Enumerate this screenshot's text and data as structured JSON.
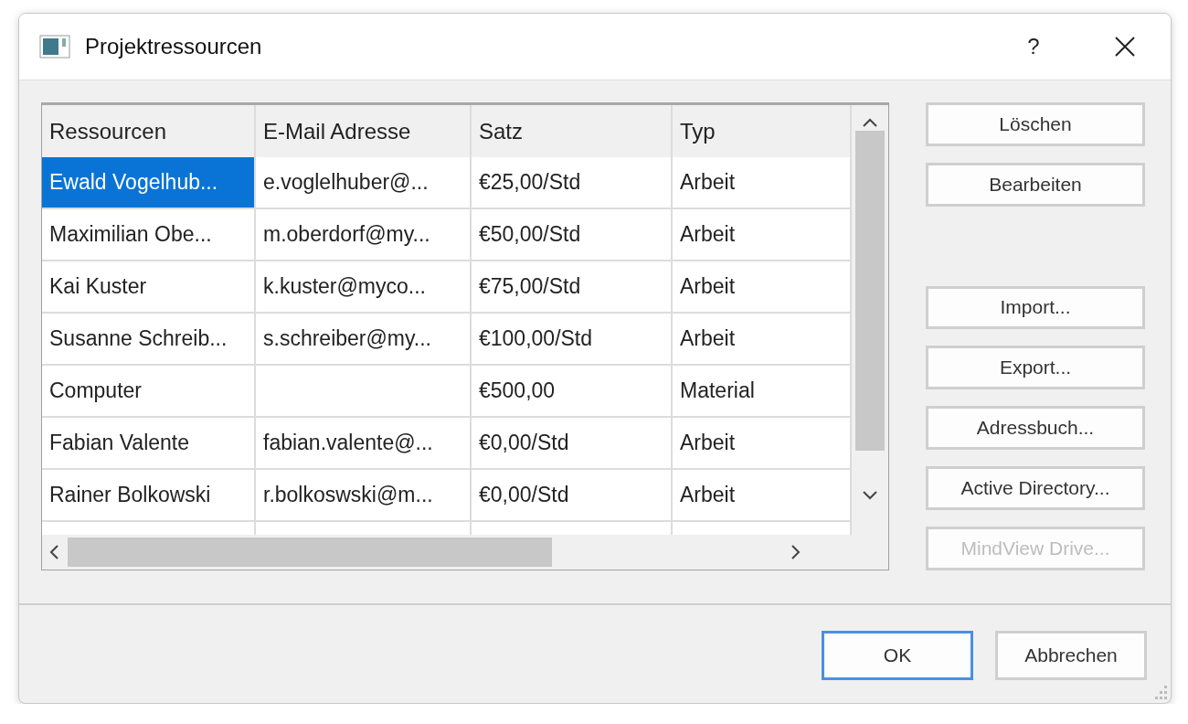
{
  "window": {
    "title": "Projektressourcen",
    "help": "?"
  },
  "table": {
    "columns": [
      "Ressourcen",
      "E-Mail Adresse",
      "Satz",
      "Typ"
    ],
    "rows": [
      {
        "cells": [
          "Ewald Vogelhub...",
          "e.voglelhuber@...",
          "€25,00/Std",
          "Arbeit"
        ],
        "selected": true
      },
      {
        "cells": [
          "Maximilian Obe...",
          "m.oberdorf@my...",
          "€50,00/Std",
          "Arbeit"
        ],
        "selected": false
      },
      {
        "cells": [
          "Kai Kuster",
          "k.kuster@myco...",
          "€75,00/Std",
          "Arbeit"
        ],
        "selected": false
      },
      {
        "cells": [
          "Susanne Schreib...",
          "s.schreiber@my...",
          "€100,00/Std",
          "Arbeit"
        ],
        "selected": false
      },
      {
        "cells": [
          "Computer",
          "",
          "€500,00",
          "Material"
        ],
        "selected": false
      },
      {
        "cells": [
          "Fabian Valente",
          "fabian.valente@...",
          "€0,00/Std",
          "Arbeit"
        ],
        "selected": false
      },
      {
        "cells": [
          "Rainer Bolkowski",
          "r.bolkoswski@m...",
          "€0,00/Std",
          "Arbeit"
        ],
        "selected": false
      }
    ]
  },
  "edit_buttons": [
    {
      "label": "Löschen",
      "disabled": false
    },
    {
      "label": "Bearbeiten",
      "disabled": false
    }
  ],
  "import_buttons": [
    {
      "label": "Import...",
      "disabled": false
    },
    {
      "label": "Export...",
      "disabled": false
    },
    {
      "label": "Adressbuch...",
      "disabled": false
    },
    {
      "label": "Active Directory...",
      "disabled": false
    },
    {
      "label": "MindView Drive...",
      "disabled": true
    }
  ],
  "footer_buttons": [
    {
      "label": "OK",
      "default": true
    },
    {
      "label": "Abbrechen",
      "default": false
    }
  ]
}
